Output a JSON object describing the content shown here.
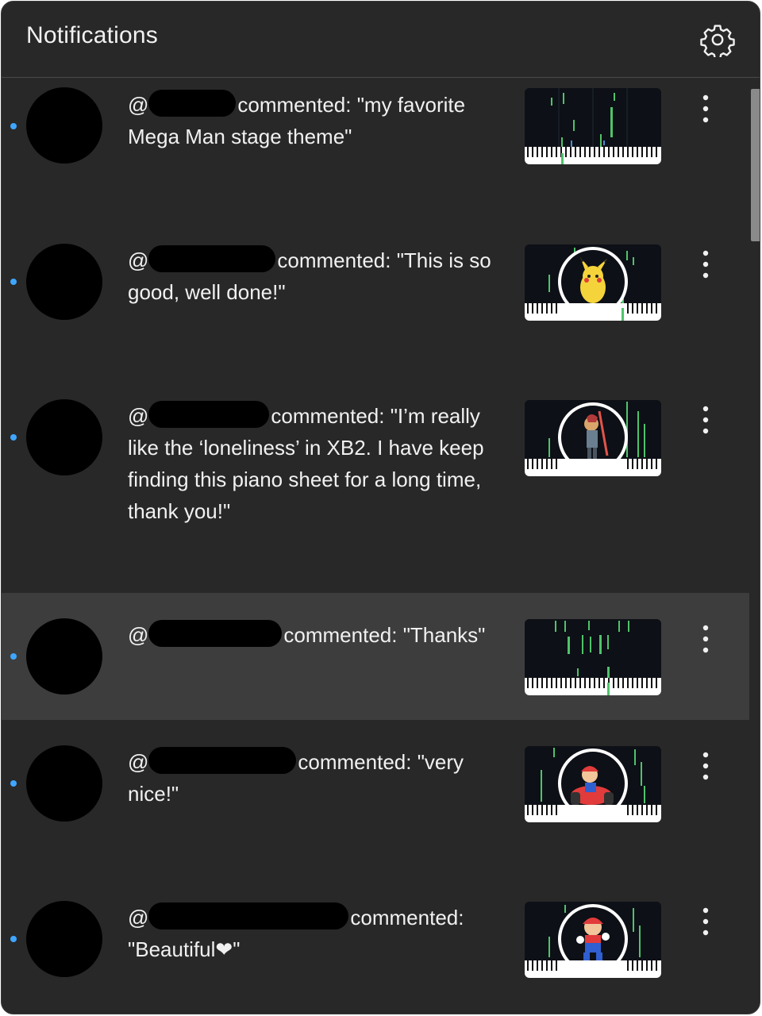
{
  "header": {
    "title": "Notifications",
    "settings_icon": "gear-icon"
  },
  "colors": {
    "panel_bg": "#282828",
    "highlight_bg": "#3d3d3d",
    "unread_dot": "#3ea6ff",
    "text": "#f1f1f1"
  },
  "notifications": [
    {
      "prefix": "@",
      "comment": "commented: \"my favorite Mega Man stage theme\"",
      "unread": true,
      "thumbnail": "piano-roll-plain"
    },
    {
      "prefix": "@",
      "comment": "commented: \"This is so good, well done!\"",
      "unread": true,
      "thumbnail": "piano-roll-pikachu"
    },
    {
      "prefix": "@",
      "comment": "commented: \"I’m really like the ‘loneliness’ in XB2. I have keep finding this piano sheet for a long time, thank you!\"",
      "unread": true,
      "thumbnail": "piano-roll-swordfighter"
    },
    {
      "prefix": "@",
      "comment": "commented: \"Thanks\"",
      "unread": true,
      "thumbnail": "piano-roll-plain",
      "highlighted": true
    },
    {
      "prefix": "@",
      "comment": "commented: \"very nice!\"",
      "unread": true,
      "thumbnail": "piano-roll-kart"
    },
    {
      "prefix": "@",
      "comment": "commented: \"Beautiful❤\"",
      "unread": true,
      "thumbnail": "piano-roll-mario"
    }
  ],
  "icons": {
    "more": "more-vert-icon",
    "avatar": "avatar"
  }
}
